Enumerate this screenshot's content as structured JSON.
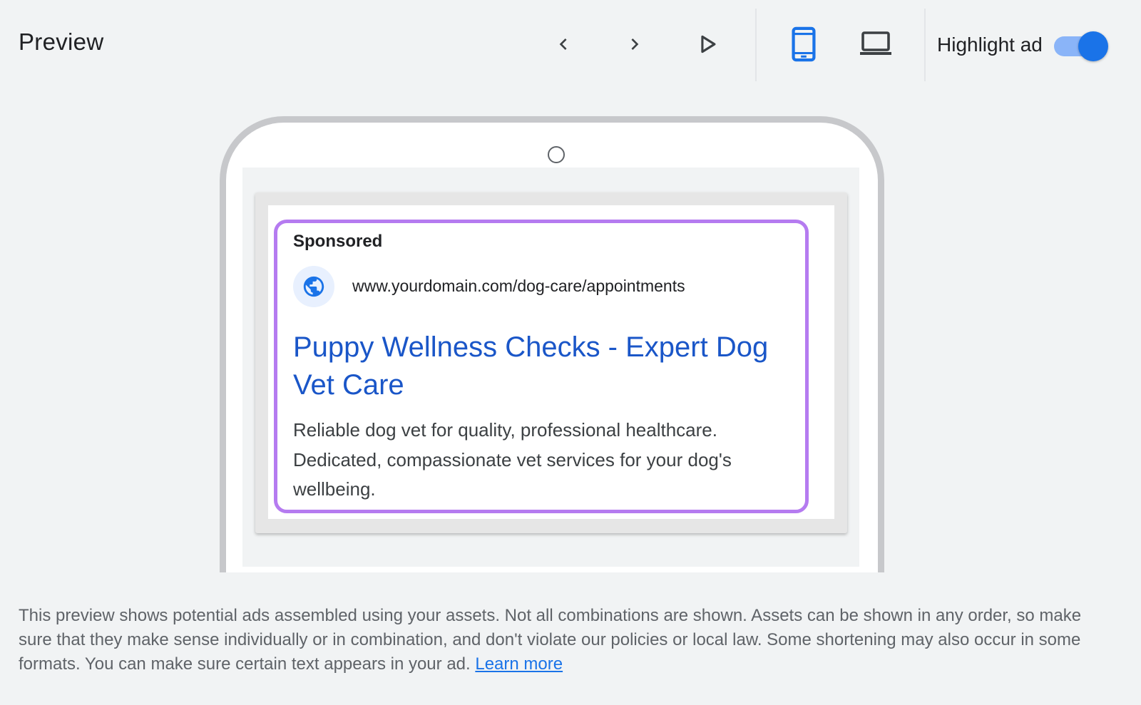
{
  "header": {
    "title": "Preview",
    "highlight_label": "Highlight ad",
    "highlight_enabled": true,
    "selected_device": "mobile",
    "icons": [
      "chevron-left-icon",
      "chevron-right-icon",
      "play-icon",
      "smartphone-icon",
      "laptop-icon"
    ]
  },
  "ad": {
    "sponsored_label": "Sponsored",
    "display_url": "www.yourdomain.com/dog-care/appointments",
    "headline": "Puppy Wellness Checks - Expert Dog Vet Care",
    "description": "Reliable dog vet for quality, professional healthcare. Dedicated, compassionate vet services for your dog's wellbeing.",
    "favicon_icon": "globe-icon"
  },
  "footer": {
    "disclaimer": "This preview shows potential ads assembled using your assets. Not all combinations are shown. Assets can be shown in any order, so make sure that they make sense individually or in combination, and don't violate our policies or local law. Some shortening may also occur in some formats. You can make sure certain text appears in your ad.",
    "learn_more": "Learn more"
  },
  "colors": {
    "accent": "#1a73e8",
    "headline_link": "#1a56c8",
    "highlight_border": "#b57bf0",
    "background": "#f1f3f4"
  }
}
